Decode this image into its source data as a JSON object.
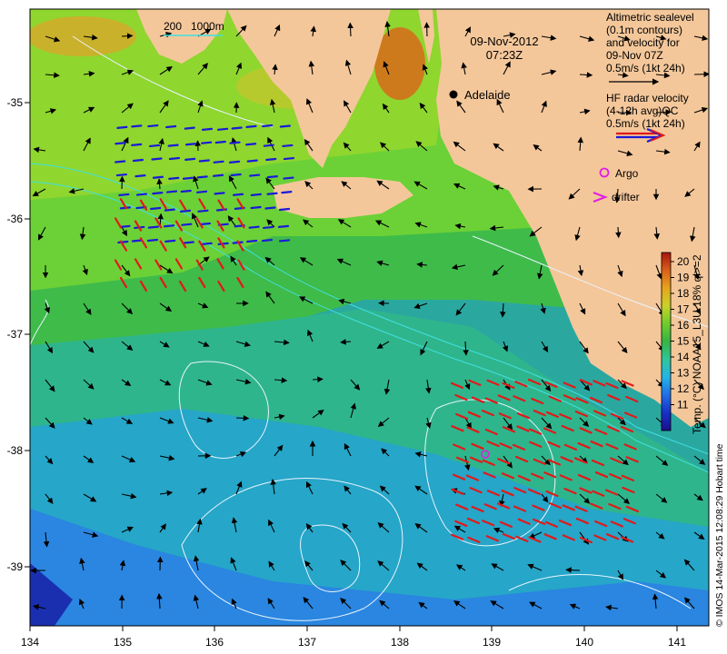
{
  "title": {
    "date": "09-Nov-2012",
    "time": "07:23Z"
  },
  "isobath_legend": {
    "depth_a": "200",
    "depth_b": "1000m"
  },
  "place": {
    "name": "Adelaide"
  },
  "legend": {
    "altimetry_lines": [
      "Altimetric sealevel",
      "(0.1m contours)",
      "and velocity for",
      "09-Nov 07Z",
      "0.5m/s (1kt 24h)"
    ],
    "radar_lines": [
      "HF radar velocity",
      "(4-12h avg)QC",
      "0.5m/s (1kt 24h)"
    ],
    "argo_label": "Argo",
    "drifter_label": "drifter"
  },
  "colorbar": {
    "label": "Temp. (°C) NOAA15_L3U 18% ql>=2",
    "ticks": [
      "11",
      "12",
      "13",
      "14",
      "15",
      "16",
      "17",
      "18",
      "19",
      "20"
    ],
    "colors": [
      "#1a0f8c",
      "#1830c8",
      "#1e6fe6",
      "#26b4e8",
      "#2fc79a",
      "#36b444",
      "#6fcc2c",
      "#c9d22a",
      "#e6a41e",
      "#d8601a",
      "#a8140c"
    ]
  },
  "axes": {
    "x_ticks": [
      "134",
      "135",
      "136",
      "137",
      "138",
      "139",
      "140",
      "141"
    ],
    "y_ticks": [
      "-35",
      "-36",
      "-37",
      "-38",
      "-39"
    ]
  },
  "credit": "© IMOS 14-Mar-2015 12:08:29 Hobart time",
  "colors": {
    "land": "#f4c79a",
    "altimetry_arrow": "#000000",
    "radar_arrow_west": "#1a1ad8",
    "radar_arrow_east": "#e01a1a",
    "argo": "#e020e0",
    "contour": "#e8f4ff",
    "isobath": "#40e0e0"
  }
}
